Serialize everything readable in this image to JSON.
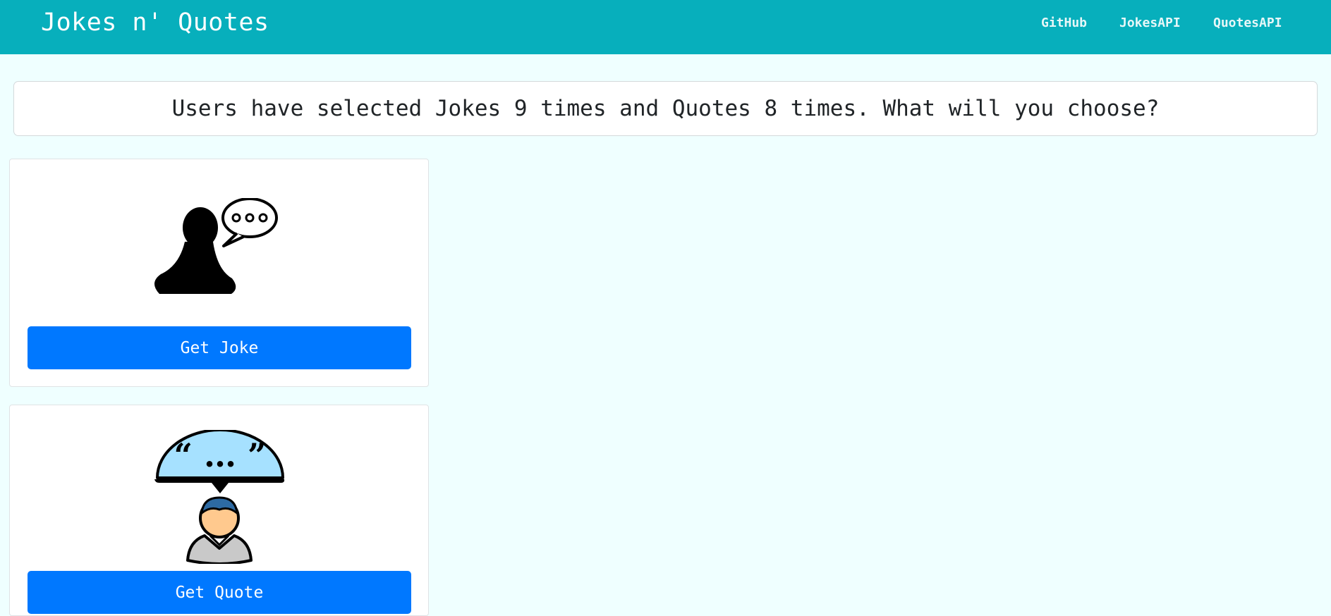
{
  "navbar": {
    "brand": "Jokes n' Quotes",
    "links": [
      {
        "label": "GitHub"
      },
      {
        "label": "JokesAPI"
      },
      {
        "label": "QuotesAPI"
      }
    ],
    "background": "#07afbc"
  },
  "banner": {
    "text": "Users have selected Jokes 9 times and Quotes 8 times. What will you choose?"
  },
  "cards": [
    {
      "icon": "person-speech-bubble-icon",
      "button_label": "Get Joke"
    },
    {
      "icon": "person-quote-bubble-icon",
      "button_label": "Get Quote"
    }
  ],
  "colors": {
    "accent": "#0078ff",
    "page_background": "#efffff",
    "quote_bubble": "#a6e1ff",
    "face": "#ffc98e"
  }
}
